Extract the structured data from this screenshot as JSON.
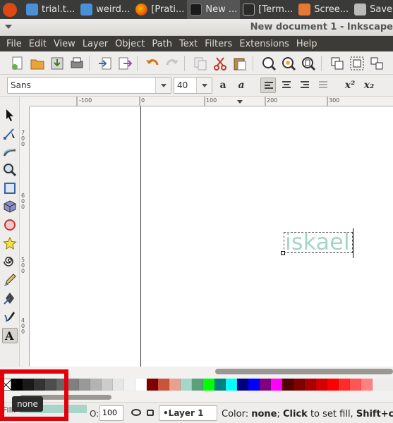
{
  "taskbar": {
    "items": [
      {
        "label": "",
        "icon": "ubuntu-logo-icon"
      },
      {
        "label": "trial.t...",
        "icon": "app-icon"
      },
      {
        "label": "weird...",
        "icon": "app-icon"
      },
      {
        "label": "[Prati...",
        "icon": "firefox-icon"
      },
      {
        "label": "New ...",
        "icon": "inkscape-icon"
      },
      {
        "label": "[Term...",
        "icon": "terminal-icon"
      },
      {
        "label": "Scree...",
        "icon": "folder-icon"
      },
      {
        "label": "Save ...",
        "icon": "camera-icon"
      }
    ]
  },
  "window": {
    "title": "New document 1 - Inkscape"
  },
  "menu": [
    "File",
    "Edit",
    "View",
    "Layer",
    "Object",
    "Path",
    "Text",
    "Filters",
    "Extensions",
    "Help"
  ],
  "text_toolbar": {
    "font_family": "Sans",
    "font_size": "40",
    "superscript_label": "x²",
    "subscript_label": "x₂"
  },
  "rulers": {
    "horizontal": [
      "-100",
      "0",
      "100",
      "200",
      "300"
    ],
    "vertical": [
      "700",
      "600",
      "500",
      "400"
    ]
  },
  "canvas": {
    "text_object": "iskael",
    "text_color": "#a7d5c9"
  },
  "palette": {
    "colors": [
      "#000000",
      "#1a1a1a",
      "#333333",
      "#4d4d4d",
      "#666666",
      "#808080",
      "#999999",
      "#b3b3b3",
      "#cccccc",
      "#e6e6e6",
      "#f2f2f2",
      "#ffffff",
      "#800000",
      "#c8543a",
      "#e9a08f",
      "#a7d5c9",
      "#5aa07a",
      "#00ff00",
      "#008080",
      "#00ffff",
      "#000080",
      "#0000ff",
      "#800080",
      "#ff00ff",
      "#550000",
      "#800000",
      "#aa0000",
      "#d40000",
      "#ff0000",
      "#ff2a2a",
      "#ff5555",
      "#ff8080"
    ]
  },
  "status": {
    "fill_label": "Fill:",
    "fill_color": "#a7d5c9",
    "opacity_label": "O:",
    "opacity_value": "100",
    "layer": "•Layer 1",
    "msg_color_label": "Color: ",
    "msg_color_value": "none",
    "msg_sep": "; ",
    "msg_click": "Click",
    "msg_mid": " to set fill, ",
    "msg_shift": "Shift+click"
  },
  "tooltip": {
    "text": "none"
  },
  "accent": {
    "highlight": "#e3000b"
  }
}
